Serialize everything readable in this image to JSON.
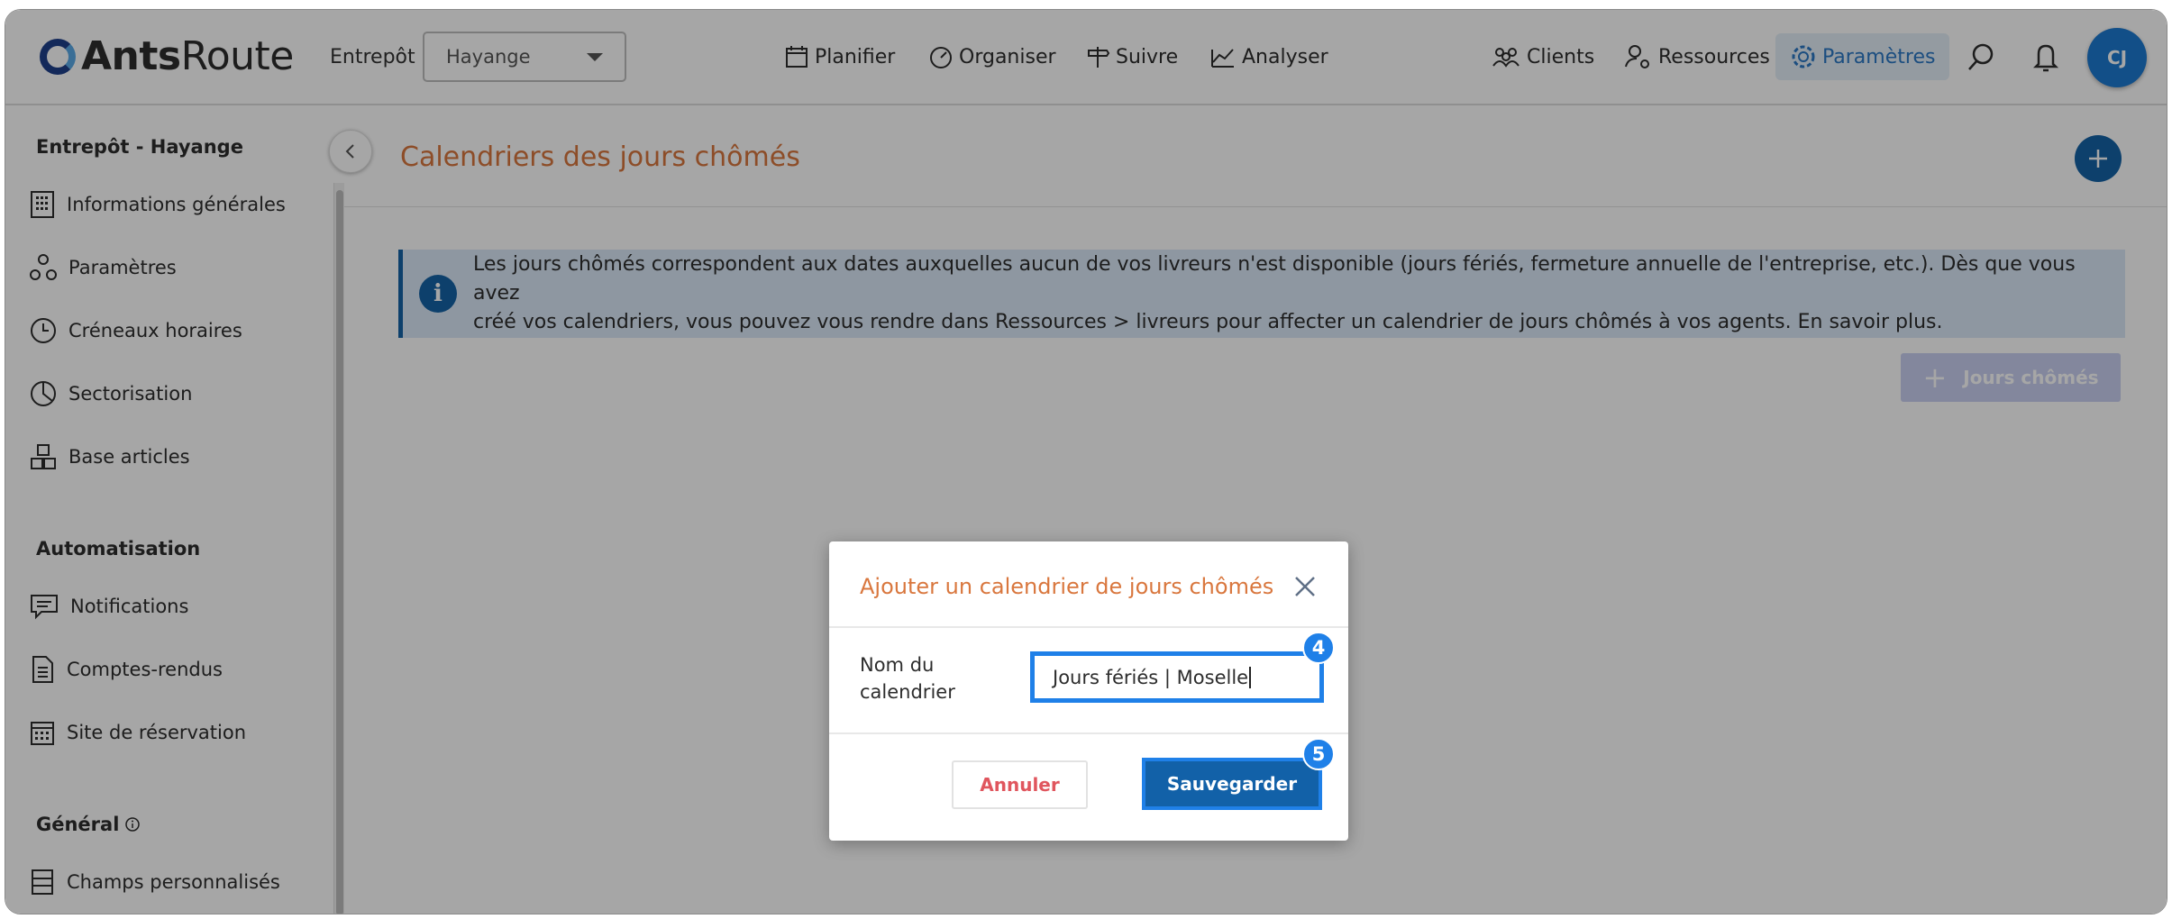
{
  "header": {
    "brand_bold": "Ants",
    "brand_light": "Route",
    "warehouse_label": "Entrepôt",
    "warehouse_value": "Hayange",
    "nav": [
      "Planifier",
      "Organiser",
      "Suivre",
      "Analyser"
    ],
    "right_nav": [
      "Clients",
      "Ressources",
      "Paramètres"
    ],
    "active_nav": "Paramètres",
    "avatar_initials": "CJ"
  },
  "sidebar": {
    "section1_title": "Entrepôt - Hayange",
    "section1_items": [
      {
        "label": "Informations générales",
        "icon": "building-icon"
      },
      {
        "label": "Paramètres",
        "icon": "settings-nodes-icon"
      },
      {
        "label": "Créneaux horaires",
        "icon": "clock-icon"
      },
      {
        "label": "Sectorisation",
        "icon": "pie-icon"
      },
      {
        "label": "Base articles",
        "icon": "boxes-icon"
      }
    ],
    "section2_title": "Automatisation",
    "section2_items": [
      {
        "label": "Notifications",
        "icon": "message-icon"
      },
      {
        "label": "Comptes-rendus",
        "icon": "document-icon"
      },
      {
        "label": "Site de réservation",
        "icon": "calendar-icon"
      }
    ],
    "section3_title": "Général",
    "section3_items": [
      {
        "label": "Champs personnalisés",
        "icon": "list-icon"
      }
    ]
  },
  "main": {
    "title": "Calendriers des jours chômés",
    "info_line1": "Les jours chômés correspondent aux dates auxquelles aucun de vos livreurs n'est disponible (jours fériés, fermeture annuelle de l'entreprise, etc.). Dès que vous avez",
    "info_line2": "créé vos calendriers, vous pouvez vous rendre dans Ressources > livreurs pour affecter un calendrier de jours chômés à vos agents. En savoir plus.",
    "jours_button": "Jours chômés"
  },
  "modal": {
    "title": "Ajouter un calendrier de jours chômés",
    "field_label_line1": "Nom du",
    "field_label_line2": "calendrier",
    "field_value": "Jours fériés | Moselle",
    "cancel_label": "Annuler",
    "save_label": "Sauvegarder",
    "step_input": "4",
    "step_save": "5"
  },
  "colors": {
    "accent_orange": "#d9773e",
    "primary_blue": "#1463a6",
    "highlight_blue": "#1f80e8",
    "cancel_red": "#e0565e"
  }
}
